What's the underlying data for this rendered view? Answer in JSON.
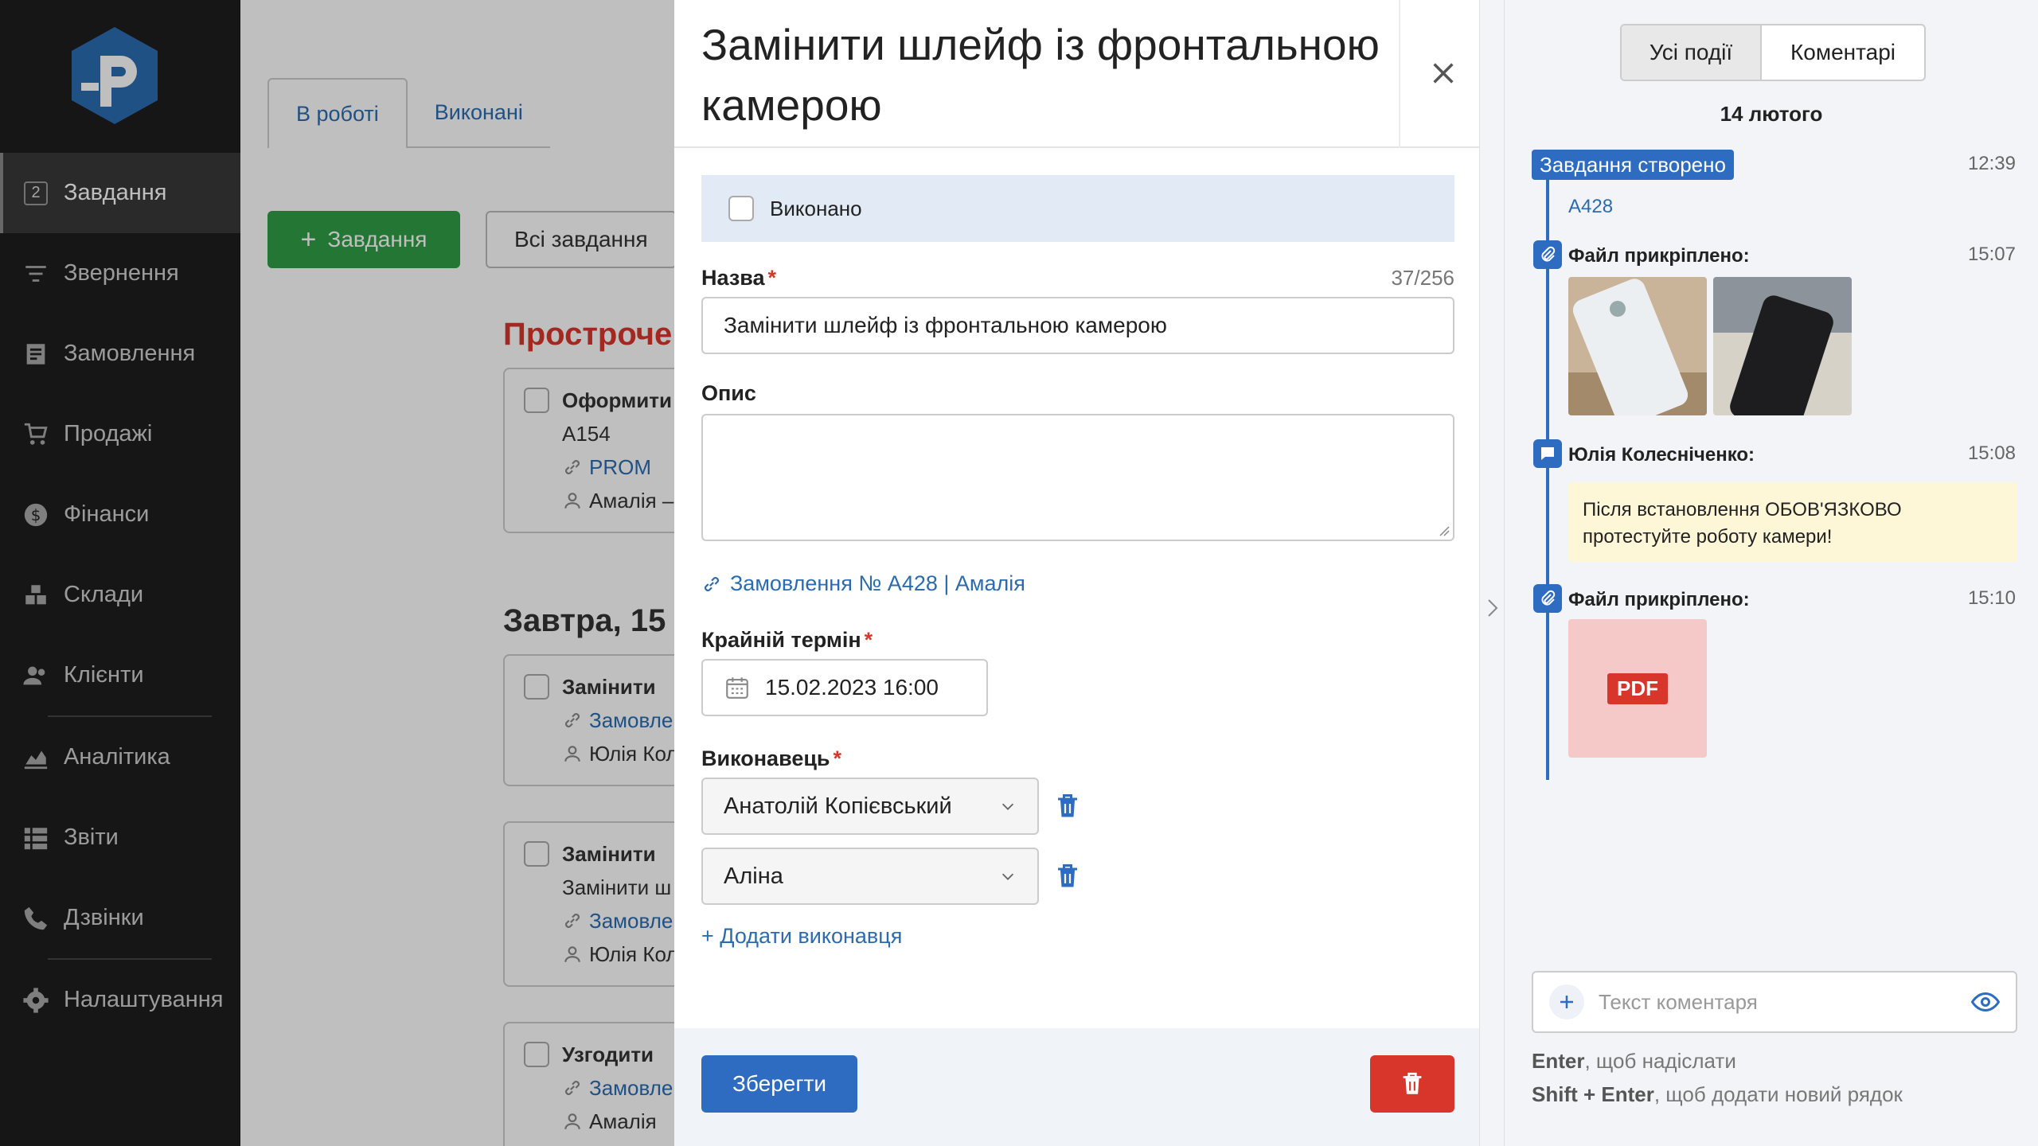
{
  "sidebar": {
    "badge": "2",
    "items": [
      {
        "label": "Завдання",
        "icon": "tasks-icon"
      },
      {
        "label": "Звернення",
        "icon": "filter-icon"
      },
      {
        "label": "Замовлення",
        "icon": "orders-icon"
      },
      {
        "label": "Продажі",
        "icon": "cart-icon"
      },
      {
        "label": "Фінанси",
        "icon": "dollar-icon"
      },
      {
        "label": "Склади",
        "icon": "warehouse-icon"
      },
      {
        "label": "Клієнти",
        "icon": "users-icon"
      },
      {
        "label": "Аналітика",
        "icon": "chart-icon"
      },
      {
        "label": "Звіти",
        "icon": "list-icon"
      },
      {
        "label": "Дзвінки",
        "icon": "phone-icon"
      },
      {
        "label": "Налаштування",
        "icon": "gear-icon"
      }
    ]
  },
  "background": {
    "tabs": [
      "В роботі",
      "Виконані"
    ],
    "add_button": "Завдання",
    "all_tasks": "Всі завдання",
    "section_overdue": "Простроче",
    "section_tomorrow": "Завтра, 15",
    "cards": [
      {
        "title": "Оформити",
        "line2": "A154",
        "link": "PROM",
        "user": "Амалія –"
      },
      {
        "title": "Замінити",
        "link": "Замовле",
        "user": "Юлія Кол"
      },
      {
        "title": "Замінити",
        "line2": "Замінити ш",
        "link": "Замовле",
        "user": "Юлія Кол"
      },
      {
        "title": "Узгодити",
        "link": "Замовле",
        "user": "Амалія"
      }
    ]
  },
  "modal": {
    "title": "Замінити шлейф із фронтальною камерою",
    "done_label": "Виконано",
    "name_label": "Назва",
    "name_counter": "37/256",
    "name_value": "Замінити шлейф із фронтальною камерою",
    "desc_label": "Опис",
    "order_link": "Замовлення № A428 | Амалія",
    "deadline_label": "Крайній термін",
    "deadline_value": "15.02.2023 16:00",
    "executor_label": "Виконавець",
    "executors": [
      "Анатолій Копієвський",
      "Аліна"
    ],
    "add_executor": "+ Додати виконавця",
    "save_button": "Зберегти"
  },
  "panel": {
    "seg_all": "Усі події",
    "seg_comments": "Коментарі",
    "date": "14 лютого",
    "events": [
      {
        "label": "Завдання створено",
        "time": "12:39",
        "link": "A428"
      },
      {
        "label": "Файл прикріплено:",
        "time": "15:07"
      },
      {
        "label": "Юлія Колесніченко:",
        "time": "15:08",
        "text": "Після встановлення ОБОВ'ЯЗКОВО протестуйте роботу камери!"
      },
      {
        "label": "Файл прикріплено:",
        "time": "15:10",
        "file_type": "PDF"
      }
    ],
    "comment_placeholder": "Текст коментаря",
    "hint1_key": "Enter",
    "hint1_text": ", щоб надіслати",
    "hint2_key": "Shift + Enter",
    "hint2_text": ", щоб додати новий рядок"
  },
  "colors": {
    "accent": "#2d6cc0",
    "danger": "#d9362b",
    "success": "#2f9e44",
    "sidebar": "#1e1e1e"
  }
}
